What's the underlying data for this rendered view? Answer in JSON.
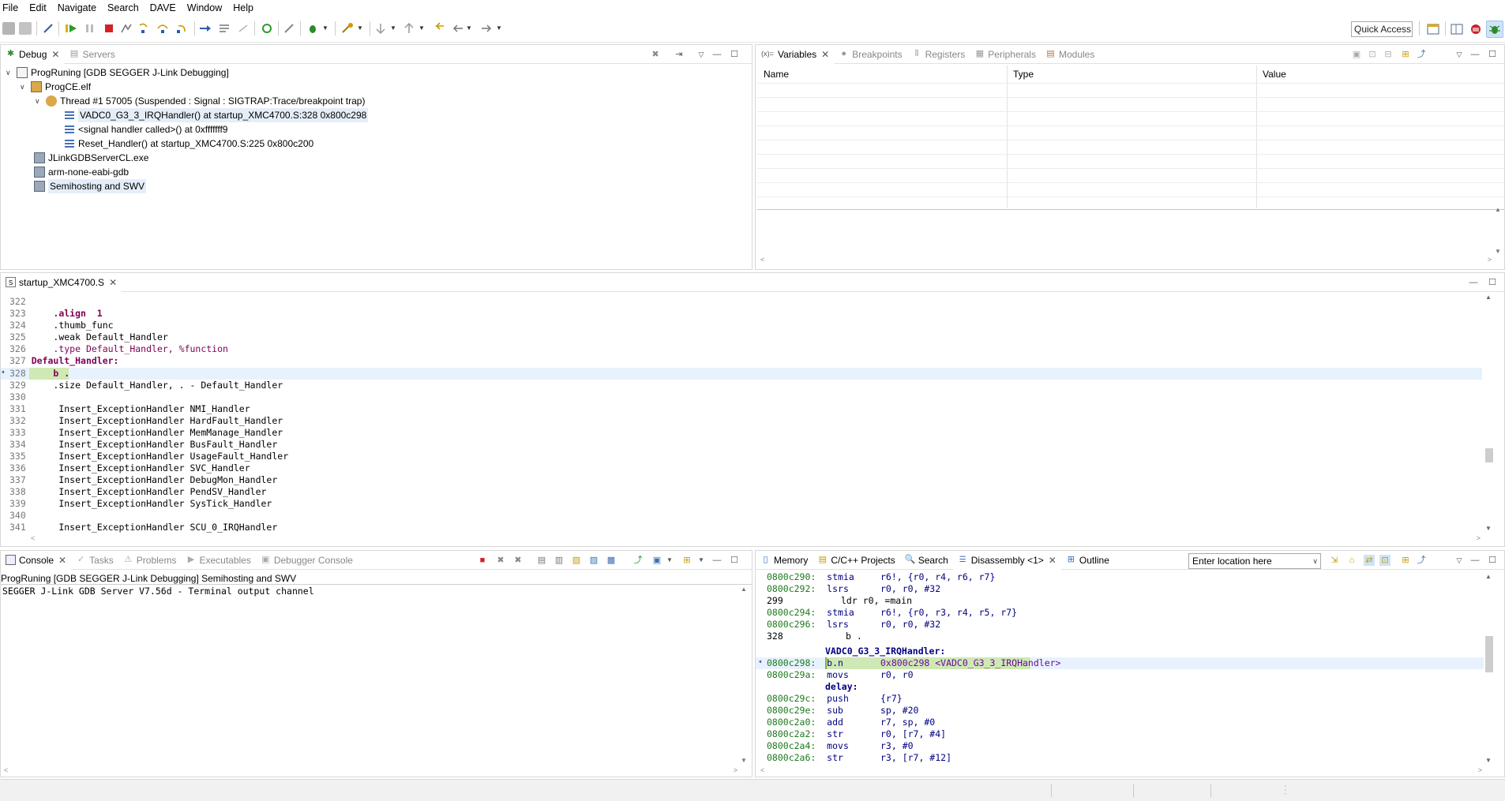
{
  "menu": [
    "File",
    "Edit",
    "Navigate",
    "Search",
    "DAVE",
    "Window",
    "Help"
  ],
  "toolbar": {
    "quick_access": "Quick Access"
  },
  "debug_view": {
    "tabs": [
      {
        "label": "Debug",
        "active": true
      },
      {
        "label": "Servers",
        "active": false
      }
    ],
    "tree": {
      "launch": "ProgRuning [GDB SEGGER J-Link Debugging]",
      "elf": "ProgCE.elf",
      "thread": "Thread #1 57005 (Suspended : Signal : SIGTRAP:Trace/breakpoint trap)",
      "frames": [
        "VADC0_G3_3_IRQHandler() at startup_XMC4700.S:328 0x800c298",
        "<signal handler called>() at 0xfffffff9",
        "Reset_Handler() at startup_XMC4700.S:225 0x800c200"
      ],
      "processes": [
        "JLinkGDBServerCL.exe",
        "arm-none-eabi-gdb",
        "Semihosting and SWV"
      ]
    }
  },
  "variables_view": {
    "tabs": [
      {
        "label": "Variables",
        "active": true
      },
      {
        "label": "Breakpoints",
        "active": false
      },
      {
        "label": "Registers",
        "active": false
      },
      {
        "label": "Peripherals",
        "active": false
      },
      {
        "label": "Modules",
        "active": false
      }
    ],
    "columns": [
      "Name",
      "Type",
      "Value"
    ]
  },
  "editor": {
    "tab": "startup_XMC4700.S",
    "lines": [
      {
        "n": "322",
        "text": ""
      },
      {
        "n": "323",
        "text": "    .align  1"
      },
      {
        "n": "324",
        "text": "    .thumb_func"
      },
      {
        "n": "325",
        "text": "    .weak Default_Handler"
      },
      {
        "n": "326",
        "text": "    .type Default_Handler, %function"
      },
      {
        "n": "327",
        "text": "Default_Handler:"
      },
      {
        "n": "328",
        "text": "    b ."
      },
      {
        "n": "329",
        "text": "    .size Default_Handler, . - Default_Handler"
      },
      {
        "n": "330",
        "text": ""
      },
      {
        "n": "331",
        "text": "     Insert_ExceptionHandler NMI_Handler"
      },
      {
        "n": "332",
        "text": "     Insert_ExceptionHandler HardFault_Handler"
      },
      {
        "n": "333",
        "text": "     Insert_ExceptionHandler MemManage_Handler"
      },
      {
        "n": "334",
        "text": "     Insert_ExceptionHandler BusFault_Handler"
      },
      {
        "n": "335",
        "text": "     Insert_ExceptionHandler UsageFault_Handler"
      },
      {
        "n": "336",
        "text": "     Insert_ExceptionHandler SVC_Handler"
      },
      {
        "n": "337",
        "text": "     Insert_ExceptionHandler DebugMon_Handler"
      },
      {
        "n": "338",
        "text": "     Insert_ExceptionHandler PendSV_Handler"
      },
      {
        "n": "339",
        "text": "     Insert_ExceptionHandler SysTick_Handler"
      },
      {
        "n": "340",
        "text": ""
      },
      {
        "n": "341",
        "text": "     Insert_ExceptionHandler SCU_0_IRQHandler"
      }
    ]
  },
  "console_view": {
    "tabs": [
      {
        "label": "Console",
        "active": true
      },
      {
        "label": "Tasks",
        "active": false
      },
      {
        "label": "Problems",
        "active": false
      },
      {
        "label": "Executables",
        "active": false
      },
      {
        "label": "Debugger Console",
        "active": false
      }
    ],
    "header": "ProgRuning [GDB SEGGER J-Link Debugging] Semihosting and SWV",
    "output": "SEGGER J-Link GDB Server V7.56d - Terminal output channel"
  },
  "disassembly_view": {
    "tabs": [
      {
        "label": "Memory",
        "active": false
      },
      {
        "label": "C/C++ Projects",
        "active": false
      },
      {
        "label": "Search",
        "active": false
      },
      {
        "label": "Disassembly <1>",
        "active": true
      },
      {
        "label": "Outline",
        "active": false
      }
    ],
    "location_placeholder": "Enter location here",
    "lines": [
      {
        "kind": "ins",
        "addr": "0800c290:",
        "op": "stmia",
        "args": "r6!, {r0, r4, r6, r7}"
      },
      {
        "kind": "ins",
        "addr": "0800c292:",
        "op": "lsrs",
        "args": "r0, r0, #32"
      },
      {
        "kind": "src",
        "addr": "299",
        "op": "ldr",
        "args": "r0, =main"
      },
      {
        "kind": "ins",
        "addr": "0800c294:",
        "op": "stmia",
        "args": "r6!, {r0, r3, r4, r5, r7}"
      },
      {
        "kind": "ins",
        "addr": "0800c296:",
        "op": "lsrs",
        "args": "r0, r0, #32"
      },
      {
        "kind": "src",
        "addr": "328",
        "op": "b",
        "args": "."
      },
      {
        "kind": "label",
        "text": "VADC0_G3_3_IRQHandler:"
      },
      {
        "kind": "ins",
        "addr": "0800c298:",
        "op": "b.n",
        "args": "0x800c298 <VADC0_G3_3_IRQHandler>",
        "current": true
      },
      {
        "kind": "ins",
        "addr": "0800c29a:",
        "op": "movs",
        "args": "r0, r0"
      },
      {
        "kind": "label",
        "text": "delay:"
      },
      {
        "kind": "ins",
        "addr": "0800c29c:",
        "op": "push",
        "args": "{r7}"
      },
      {
        "kind": "ins",
        "addr": "0800c29e:",
        "op": "sub",
        "args": "sp, #20"
      },
      {
        "kind": "ins",
        "addr": "0800c2a0:",
        "op": "add",
        "args": "r7, sp, #0"
      },
      {
        "kind": "ins",
        "addr": "0800c2a2:",
        "op": "str",
        "args": "r0, [r7, #4]"
      },
      {
        "kind": "ins",
        "addr": "0800c2a4:",
        "op": "movs",
        "args": "r3, #0"
      },
      {
        "kind": "ins",
        "addr": "0800c2a6:",
        "op": "str",
        "args": "r3, [r7, #12]"
      }
    ]
  }
}
